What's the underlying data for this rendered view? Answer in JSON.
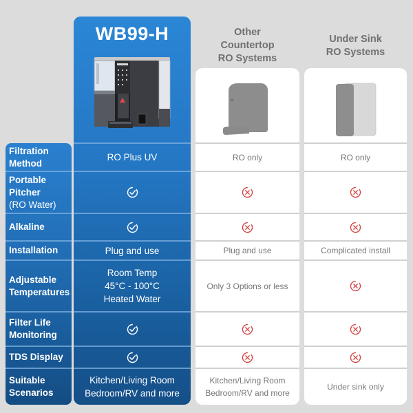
{
  "columns": {
    "main": {
      "title": "WB99-H",
      "image": "countertop-ro-dispenser-product-image"
    },
    "counter": {
      "title_lines": [
        "Other",
        "Countertop",
        "RO Systems"
      ],
      "image": "generic-countertop-unit-image"
    },
    "undersink": {
      "title_lines": [
        "Under Sink",
        "RO Systems"
      ],
      "image": "generic-under-sink-unit-image"
    }
  },
  "colors": {
    "brand_blue": "#2476c2",
    "check_icon": "#ffffff",
    "x_icon": "#d23b3b",
    "other_text": "#777777"
  },
  "rows": [
    {
      "label_lines": [
        "Filtration",
        "Method"
      ],
      "main": {
        "type": "text",
        "lines": [
          "RO Plus UV"
        ]
      },
      "counter": {
        "type": "text",
        "lines": [
          "RO only"
        ]
      },
      "undersink": {
        "type": "text",
        "lines": [
          "RO only"
        ]
      }
    },
    {
      "label_lines": [
        "Portable",
        "Pitcher"
      ],
      "label_sub": "(RO Water)",
      "main": {
        "type": "check"
      },
      "counter": {
        "type": "x"
      },
      "undersink": {
        "type": "x"
      }
    },
    {
      "label_lines": [
        "Alkaline"
      ],
      "main": {
        "type": "check"
      },
      "counter": {
        "type": "x"
      },
      "undersink": {
        "type": "x"
      }
    },
    {
      "label_lines": [
        "Installation"
      ],
      "main": {
        "type": "text",
        "lines": [
          "Plug and use"
        ]
      },
      "counter": {
        "type": "text",
        "lines": [
          "Plug and use"
        ]
      },
      "undersink": {
        "type": "text",
        "lines": [
          "Complicated install"
        ]
      }
    },
    {
      "label_lines": [
        "Adjustable",
        "Temperatures"
      ],
      "main": {
        "type": "text",
        "lines": [
          "Room Temp",
          "45°C - 100°C",
          "Heated Water"
        ]
      },
      "counter": {
        "type": "text",
        "lines": [
          "Only 3 Options or less"
        ]
      },
      "undersink": {
        "type": "x"
      }
    },
    {
      "label_lines": [
        "Filter Life",
        "Monitoring"
      ],
      "main": {
        "type": "check"
      },
      "counter": {
        "type": "x"
      },
      "undersink": {
        "type": "x"
      }
    },
    {
      "label_lines": [
        "TDS Display"
      ],
      "main": {
        "type": "check"
      },
      "counter": {
        "type": "x"
      },
      "undersink": {
        "type": "x"
      }
    },
    {
      "label_lines": [
        "Suitable",
        "Scenarios"
      ],
      "main": {
        "type": "text",
        "lines": [
          "Kitchen/Living Room",
          "Bedroom/RV and more"
        ]
      },
      "counter": {
        "type": "text",
        "lines": [
          "Kitchen/Living Room",
          "Bedroom/RV and more"
        ]
      },
      "undersink": {
        "type": "text",
        "lines": [
          "Under sink only"
        ]
      }
    }
  ]
}
